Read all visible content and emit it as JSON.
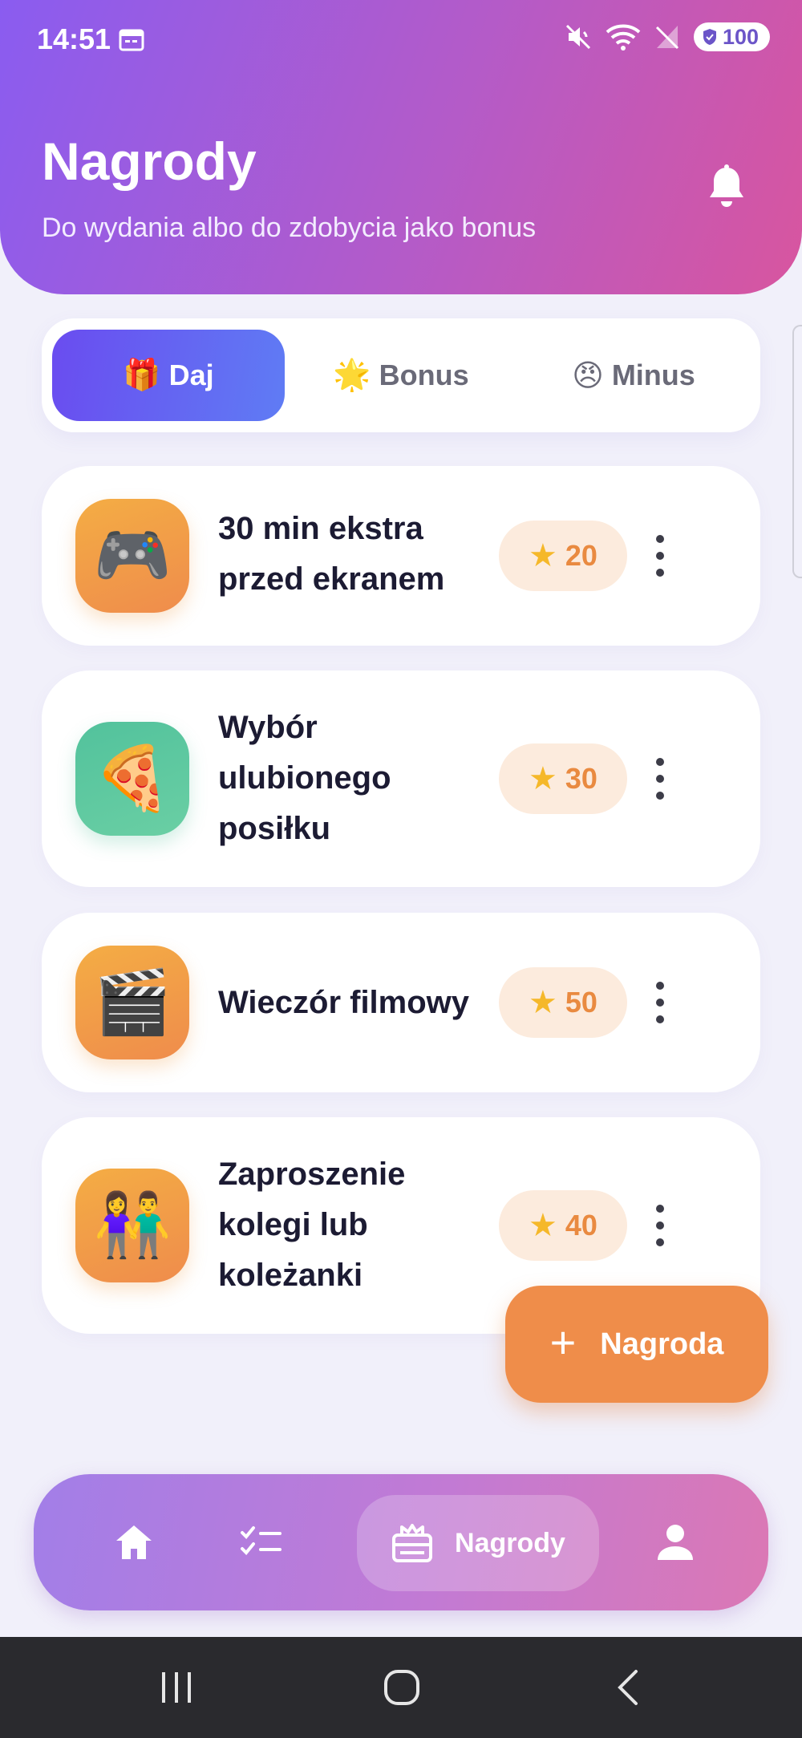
{
  "status_bar": {
    "time": "14:51",
    "battery": "100"
  },
  "header": {
    "title": "Nagrody",
    "subtitle": "Do wydania albo do zdobycia jako bonus"
  },
  "tabs": [
    {
      "icon": "gift-emoji",
      "emoji": "🎁",
      "label": "Daj",
      "active": true
    },
    {
      "icon": "glowing-star-emoji",
      "emoji": "🌟",
      "label": "Bonus",
      "active": false
    },
    {
      "icon": "angry-face-emoji",
      "emoji": "😠",
      "label": "Minus",
      "active": false
    }
  ],
  "rewards": [
    {
      "icon": "video-game-emoji",
      "emoji": "🎮",
      "title": "30 min ekstra przed ekranem",
      "points": "20",
      "color": "#f1a047"
    },
    {
      "icon": "pizza-emoji",
      "emoji": "🍕",
      "title": "Wybór ulubionego posiłku",
      "points": "30",
      "color": "#5cc8a0"
    },
    {
      "icon": "clapper-board-emoji",
      "emoji": "🎬",
      "title": "Wieczór filmowy",
      "points": "50",
      "color": "#f1a047"
    },
    {
      "icon": "couple-holding-hands-emoji",
      "emoji": "👫",
      "title": "Zaproszenie kolegi lub koleżanki",
      "points": "40",
      "color": "#f1a047"
    }
  ],
  "fab": {
    "label": "Nagroda",
    "icon": "plus-icon"
  },
  "bottom_nav": {
    "items": [
      {
        "icon": "home-icon"
      },
      {
        "icon": "checklist-icon"
      },
      {
        "icon": "gift-box-icon",
        "label": "Nagrody",
        "active": true
      },
      {
        "icon": "person-icon"
      }
    ]
  },
  "colors": {
    "accent": "#6a4cf0",
    "header_start": "#8a5cf0",
    "header_end": "#d8559f",
    "points_text": "#e98a40",
    "fab": "#ef8d4a"
  }
}
